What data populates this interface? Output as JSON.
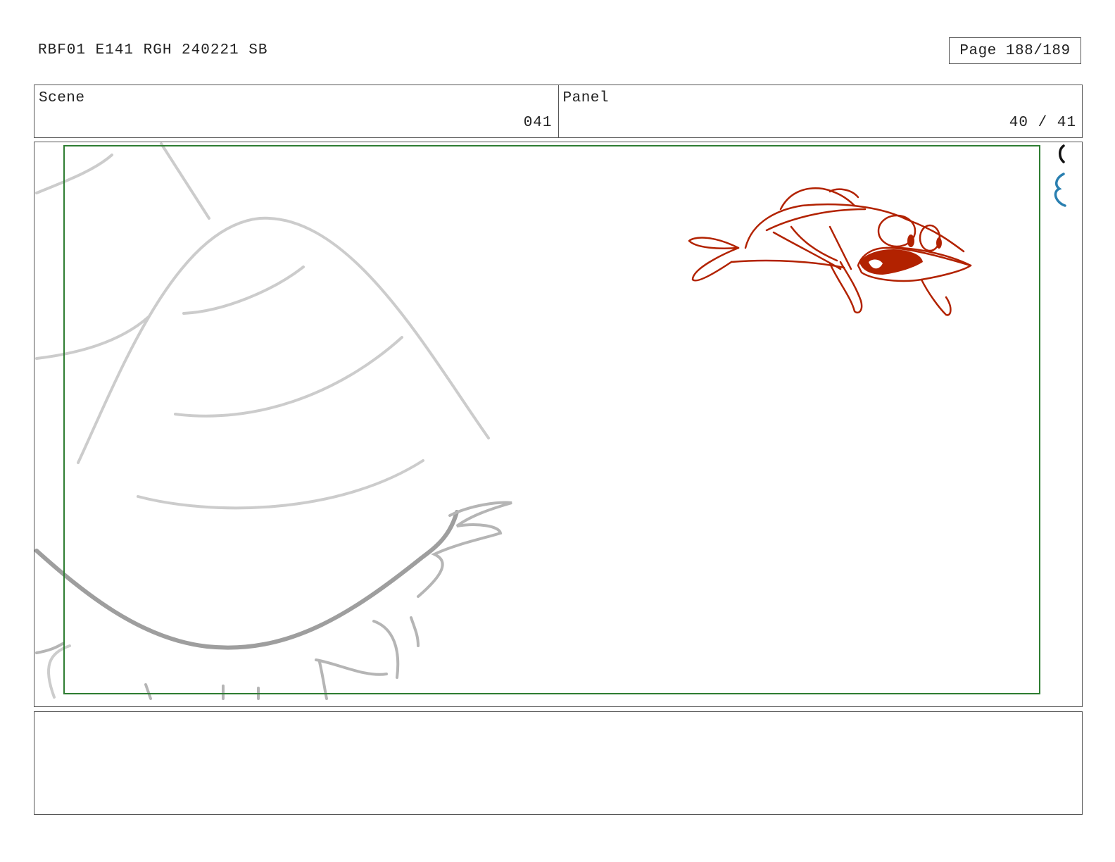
{
  "header": {
    "document_id": "RBF01 E141 RGH 240221 SB",
    "page": "Page 188/189"
  },
  "scene": {
    "label": "Scene",
    "value": "041"
  },
  "panel": {
    "label": "Panel",
    "value": "40 / 41"
  },
  "colors": {
    "safe_frame": "#2e7d32",
    "character_ink": "#b22200",
    "background_sketch": "#c8c8c8",
    "edge_mark_blue": "#2a7fb0"
  },
  "notes": {
    "text": ""
  }
}
